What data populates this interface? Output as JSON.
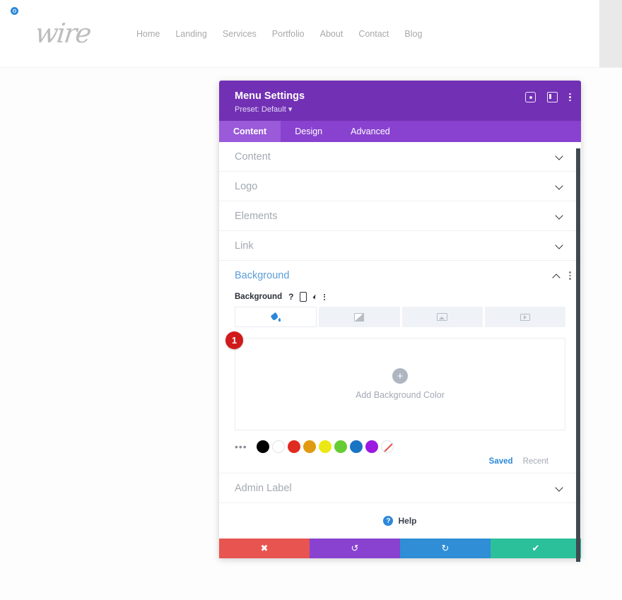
{
  "site": {
    "brand_logo_text": "wire",
    "divi_icon": "divi-circle-icon",
    "nav": [
      {
        "label": "Home"
      },
      {
        "label": "Landing"
      },
      {
        "label": "Services"
      },
      {
        "label": "Portfolio"
      },
      {
        "label": "About"
      },
      {
        "label": "Contact"
      },
      {
        "label": "Blog"
      }
    ]
  },
  "modal": {
    "title": "Menu Settings",
    "preset": "Preset: Default",
    "preset_caret": "▾",
    "header_icons": [
      {
        "name": "focus-icon"
      },
      {
        "name": "panel-toggle-icon"
      },
      {
        "name": "more-options-icon"
      }
    ],
    "tabs": [
      {
        "label": "Content",
        "active": true
      },
      {
        "label": "Design",
        "active": false
      },
      {
        "label": "Advanced",
        "active": false
      }
    ],
    "sections": [
      {
        "label": "Content",
        "open": false
      },
      {
        "label": "Logo",
        "open": false
      },
      {
        "label": "Elements",
        "open": false
      },
      {
        "label": "Link",
        "open": false
      }
    ],
    "background_section": {
      "title": "Background",
      "field_label": "Background",
      "field_icons": [
        "help-icon",
        "responsive-icon",
        "hover-icon",
        "options-icon"
      ],
      "type_tabs": [
        {
          "name": "background-color-tab",
          "active": true
        },
        {
          "name": "background-gradient-tab",
          "active": false
        },
        {
          "name": "background-image-tab",
          "active": false
        },
        {
          "name": "background-video-tab",
          "active": false
        }
      ],
      "dropzone": {
        "plus": "+",
        "label": "Add Background Color"
      },
      "annotation_badge": "1",
      "swatches_more": "•••",
      "swatches": [
        {
          "name": "swatch-black",
          "color": "#000000"
        },
        {
          "name": "swatch-white",
          "color": "#ffffff"
        },
        {
          "name": "swatch-red",
          "color": "#e02b20"
        },
        {
          "name": "swatch-orange",
          "color": "#e09a12"
        },
        {
          "name": "swatch-yellow",
          "color": "#ece813"
        },
        {
          "name": "swatch-green",
          "color": "#66cc33"
        },
        {
          "name": "swatch-blue",
          "color": "#1a74c4"
        },
        {
          "name": "swatch-purple",
          "color": "#9b19e0"
        },
        {
          "name": "swatch-transparent",
          "color": "transparent"
        }
      ],
      "saved_label": "Saved",
      "recent_label": "Recent"
    },
    "admin_label_section": {
      "label": "Admin Label"
    },
    "help": {
      "icon": "?",
      "label": "Help"
    },
    "actions": [
      {
        "name": "cancel-button",
        "glyph": "✖",
        "color": "#e8544f"
      },
      {
        "name": "undo-button",
        "glyph": "↺",
        "color": "#8842cf"
      },
      {
        "name": "redo-button",
        "glyph": "↻",
        "color": "#2f8ed6"
      },
      {
        "name": "save-button",
        "glyph": "✔",
        "color": "#2bbf9a"
      }
    ]
  }
}
